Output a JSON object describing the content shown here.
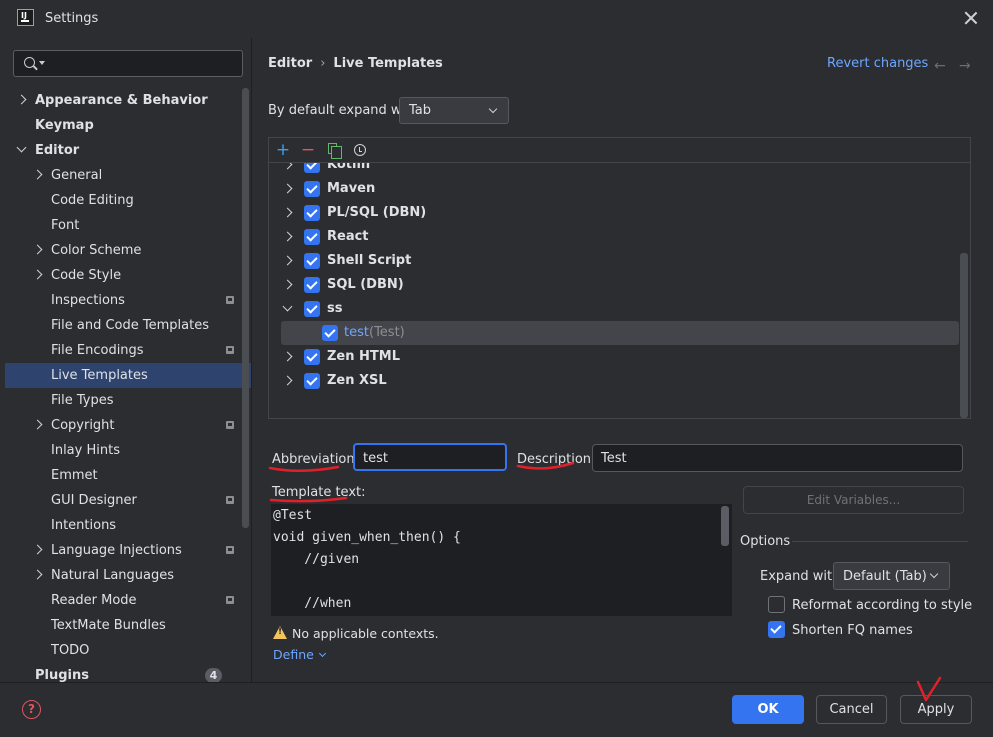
{
  "window": {
    "title": "Settings"
  },
  "search": {
    "placeholder": ""
  },
  "sidebar": {
    "items": [
      {
        "label": "Appearance & Behavior",
        "level": 0,
        "bold": true,
        "expander": "collapsed"
      },
      {
        "label": "Keymap",
        "level": 0,
        "bold": true,
        "expander": "none"
      },
      {
        "label": "Editor",
        "level": 0,
        "bold": true,
        "expander": "expanded"
      },
      {
        "label": "General",
        "level": 1,
        "expander": "collapsed"
      },
      {
        "label": "Code Editing",
        "level": 1,
        "expander": "none"
      },
      {
        "label": "Font",
        "level": 1,
        "expander": "none"
      },
      {
        "label": "Color Scheme",
        "level": 1,
        "expander": "collapsed"
      },
      {
        "label": "Code Style",
        "level": 1,
        "expander": "collapsed"
      },
      {
        "label": "Inspections",
        "level": 1,
        "expander": "none",
        "badge": true
      },
      {
        "label": "File and Code Templates",
        "level": 1,
        "expander": "none"
      },
      {
        "label": "File Encodings",
        "level": 1,
        "expander": "none",
        "badge": true
      },
      {
        "label": "Live Templates",
        "level": 1,
        "expander": "none",
        "selected": true
      },
      {
        "label": "File Types",
        "level": 1,
        "expander": "none"
      },
      {
        "label": "Copyright",
        "level": 1,
        "expander": "collapsed",
        "badge": true
      },
      {
        "label": "Inlay Hints",
        "level": 1,
        "expander": "none"
      },
      {
        "label": "Emmet",
        "level": 1,
        "expander": "none"
      },
      {
        "label": "GUI Designer",
        "level": 1,
        "expander": "none",
        "badge": true
      },
      {
        "label": "Intentions",
        "level": 1,
        "expander": "none"
      },
      {
        "label": "Language Injections",
        "level": 1,
        "expander": "collapsed",
        "badge": true
      },
      {
        "label": "Natural Languages",
        "level": 1,
        "expander": "collapsed"
      },
      {
        "label": "Reader Mode",
        "level": 1,
        "expander": "none",
        "badge": true
      },
      {
        "label": "TextMate Bundles",
        "level": 1,
        "expander": "none"
      },
      {
        "label": "TODO",
        "level": 1,
        "expander": "none"
      },
      {
        "label": "Plugins",
        "level": 0,
        "bold": true,
        "expander": "none",
        "count": "4"
      }
    ]
  },
  "header": {
    "breadcrumb": [
      "Editor",
      "Live Templates"
    ],
    "breadcrumb_sep": "›",
    "revert_label": "Revert changes",
    "back_arrow": "←",
    "forward_arrow": "→"
  },
  "expand_default": {
    "label": "By default expand with",
    "value": "Tab"
  },
  "toolbar": {
    "add": "+",
    "remove": "−"
  },
  "templates": [
    {
      "label": "Kotlin",
      "level": 0,
      "expander": "collapsed",
      "partial": true
    },
    {
      "label": "Maven",
      "level": 0,
      "expander": "collapsed"
    },
    {
      "label": "PL/SQL (DBN)",
      "level": 0,
      "expander": "collapsed"
    },
    {
      "label": "React",
      "level": 0,
      "expander": "collapsed"
    },
    {
      "label": "Shell Script",
      "level": 0,
      "expander": "collapsed"
    },
    {
      "label": "SQL (DBN)",
      "level": 0,
      "expander": "collapsed"
    },
    {
      "label": "ss",
      "level": 0,
      "expander": "expanded"
    },
    {
      "label": "test",
      "desc": "(Test)",
      "level": 1,
      "expander": "none",
      "selected": true
    },
    {
      "label": "Zen HTML",
      "level": 0,
      "expander": "collapsed"
    },
    {
      "label": "Zen XSL",
      "level": 0,
      "expander": "collapsed"
    }
  ],
  "form": {
    "abbreviation_label": "Abbreviation:",
    "abbreviation_value": "test",
    "description_label": "Description:",
    "description_value": "Test",
    "template_text_label": "Template text:",
    "edit_variables_label": "Edit Variables...",
    "code_lines": [
      "@Test",
      "void given_when_then() {",
      "    //given",
      "",
      "    //when"
    ]
  },
  "options": {
    "title": "Options",
    "expand_with_label": "Expand with",
    "expand_with_value": "Default (Tab)",
    "reformat_label": "Reformat according to style",
    "reformat_checked": false,
    "shorten_label": "Shorten FQ names",
    "shorten_checked": true
  },
  "contexts": {
    "warning": "No applicable contexts.",
    "define_label": "Define"
  },
  "footer": {
    "help": "?",
    "ok_label": "OK",
    "cancel_label": "Cancel",
    "apply_label": "Apply"
  },
  "colors": {
    "accent": "#3574f0",
    "link": "#6ea6ff",
    "annotation": "#e0212b",
    "warning": "#f2c55c",
    "selection": "#2e436e"
  }
}
